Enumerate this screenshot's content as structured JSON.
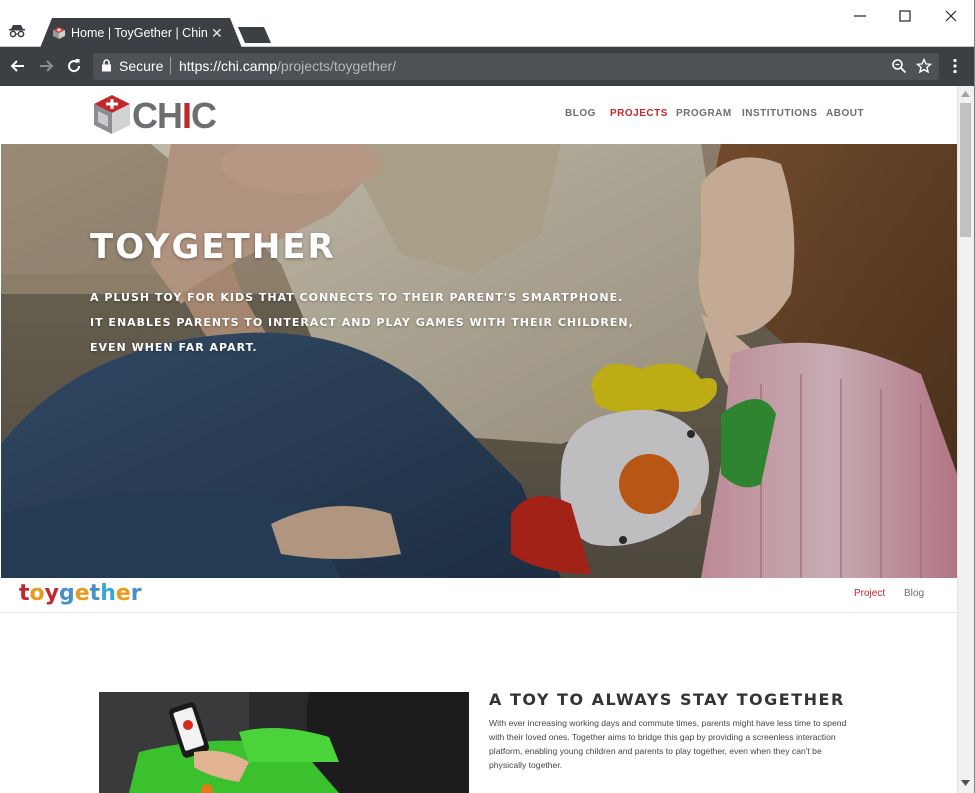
{
  "browser": {
    "tab_title": "Home | ToyGether | China",
    "secure_label": "Secure",
    "url_host": "https://chi.camp",
    "url_path": "/projects/toygether/"
  },
  "site": {
    "logo_text_prefix": "CH",
    "logo_text_red": "I",
    "logo_text_suffix": "C",
    "nav": [
      {
        "label": "BLOG",
        "active": false
      },
      {
        "label": "PROJECTS",
        "active": true
      },
      {
        "label": "PROGRAM",
        "active": false
      },
      {
        "label": "INSTITUTIONS",
        "active": false
      },
      {
        "label": "ABOUT",
        "active": false
      }
    ],
    "accent_color": "#c1272d"
  },
  "hero": {
    "title": "TOYGETHER",
    "lines": [
      "A plush toy for kids that connects to their parent's smartphone.",
      "It enables parents to interact and play games with their children,",
      "even when far apart."
    ]
  },
  "project_nav": {
    "logo_letters": [
      "t",
      "o",
      "y",
      "g",
      "e",
      "t",
      "h",
      "e",
      "r"
    ],
    "logo_colors": [
      "#c1272d",
      "#e89a1c",
      "#c1272d",
      "#4a90c8",
      "#e89a1c",
      "#4a90c8",
      "#3aa6d8",
      "#e89a1c",
      "#4a90c8"
    ],
    "links": [
      {
        "label": "Project",
        "active": true
      },
      {
        "label": "Blog",
        "active": false
      }
    ]
  },
  "section": {
    "title": "A toy to always stay together",
    "body": "With ever increasing working days and commute times, parents might have less time to spend with their loved ones. Together aims to bridge this gap by providing a screenless interaction platform, enabling young children and parents to play together, even when they can't be physically together."
  }
}
